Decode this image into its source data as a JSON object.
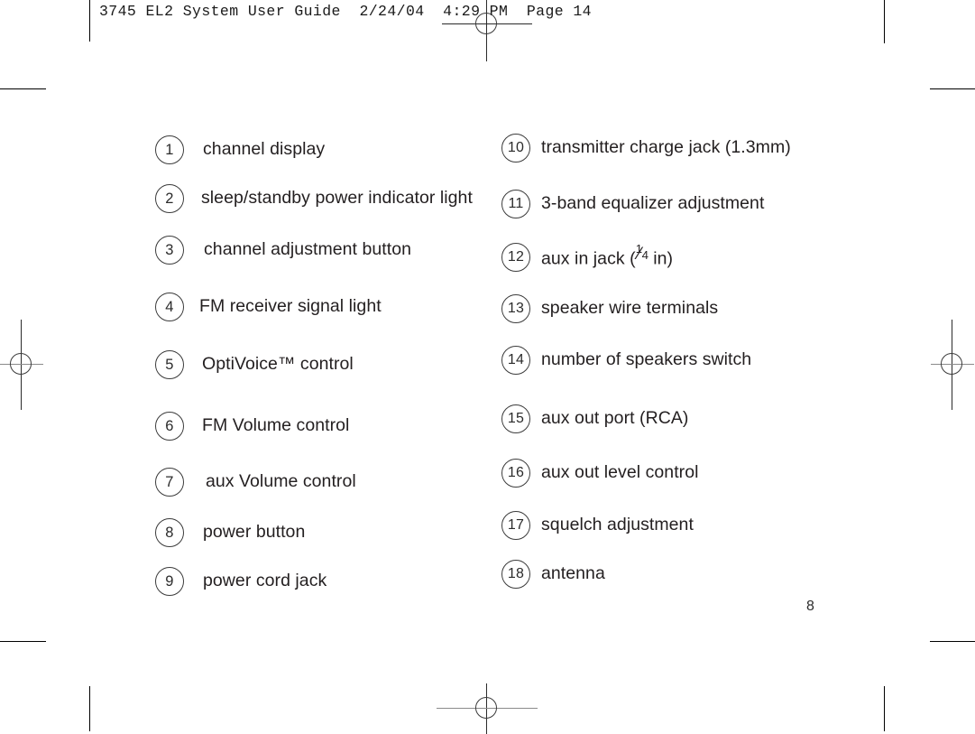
{
  "print_header": "3745 EL2 System User Guide  2/24/04  4:29 PM  Page 14",
  "page_number": "8",
  "colors": {
    "text": "#231f20",
    "circle_stroke": "#3b3b3b",
    "trim_mark": "#000000",
    "registration_line": "#2b2b2b",
    "registration_line_light": "#8b8b8b"
  },
  "callouts": {
    "left_column": [
      {
        "number": "1",
        "label": "channel display"
      },
      {
        "number": "2",
        "label": "sleep/standby power indicator light"
      },
      {
        "number": "3",
        "label": "channel adjustment button"
      },
      {
        "number": "4",
        "label": "FM receiver signal light"
      },
      {
        "number": "5",
        "label": "OptiVoice™ control"
      },
      {
        "number": "6",
        "label": "FM Volume control"
      },
      {
        "number": "7",
        "label": "aux Volume control"
      },
      {
        "number": "8",
        "label": "power button"
      },
      {
        "number": "9",
        "label": "power cord jack"
      }
    ],
    "right_column": [
      {
        "number": "10",
        "label": "transmitter charge jack (1.3mm)"
      },
      {
        "number": "11",
        "label": "3-band equalizer adjustment"
      },
      {
        "number": "12",
        "label": "aux in jack (¼ in)",
        "label_prefix": "aux in jack (",
        "fraction_numerator": "1",
        "fraction_denominator": "4",
        "label_suffix": " in)"
      },
      {
        "number": "13",
        "label": "speaker wire terminals"
      },
      {
        "number": "14",
        "label": "number of speakers switch"
      },
      {
        "number": "15",
        "label": "aux out port (RCA)"
      },
      {
        "number": "16",
        "label": "aux out level control"
      },
      {
        "number": "17",
        "label": "squelch adjustment"
      },
      {
        "number": "18",
        "label": "antenna"
      }
    ]
  }
}
